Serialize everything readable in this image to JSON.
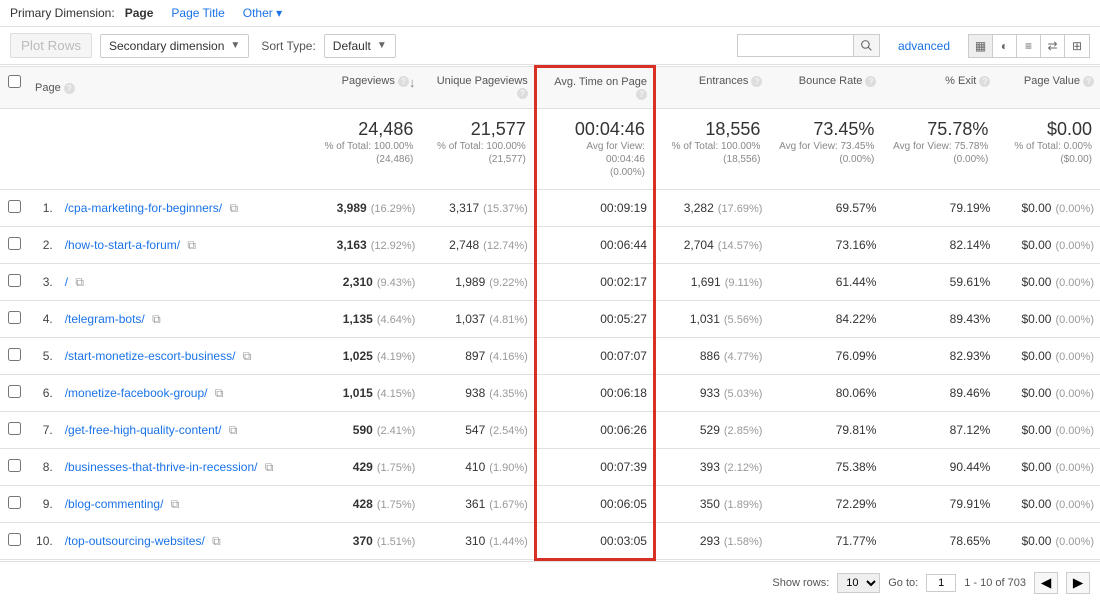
{
  "primaryDimension": {
    "label": "Primary Dimension:",
    "tabs": [
      "Page",
      "Page Title",
      "Other ▾"
    ]
  },
  "controls": {
    "plotRows": "Plot Rows",
    "secondaryDimension": "Secondary dimension",
    "sortTypeLabel": "Sort Type:",
    "sortTypeValue": "Default",
    "advanced": "advanced"
  },
  "columns": {
    "page": "Page",
    "pageviews": "Pageviews",
    "uniquePageviews": "Unique Pageviews",
    "avgTime": "Avg. Time on Page",
    "entrances": "Entrances",
    "bounceRate": "Bounce Rate",
    "pctExit": "% Exit",
    "pageValue": "Page Value"
  },
  "summary": {
    "pageviews": {
      "big": "24,486",
      "sub1": "% of Total: 100.00%",
      "sub2": "(24,486)"
    },
    "unique": {
      "big": "21,577",
      "sub1": "% of Total: 100.00%",
      "sub2": "(21,577)"
    },
    "avg": {
      "big": "00:04:46",
      "sub1": "Avg for View: 00:04:46",
      "sub2": "(0.00%)"
    },
    "entrances": {
      "big": "18,556",
      "sub1": "% of Total: 100.00%",
      "sub2": "(18,556)"
    },
    "bounce": {
      "big": "73.45%",
      "sub1": "Avg for View: 73.45%",
      "sub2": "(0.00%)"
    },
    "exit": {
      "big": "75.78%",
      "sub1": "Avg for View: 75.78%",
      "sub2": "(0.00%)"
    },
    "value": {
      "big": "$0.00",
      "sub1": "% of Total: 0.00%",
      "sub2": "($0.00)"
    }
  },
  "rows": [
    {
      "i": "1.",
      "page": "/cpa-marketing-for-beginners/",
      "pv": "3,989",
      "pvp": "(16.29%)",
      "upv": "3,317",
      "upvp": "(15.37%)",
      "avg": "00:09:19",
      "ent": "3,282",
      "entp": "(17.69%)",
      "bounce": "69.57%",
      "exit": "79.19%",
      "val": "$0.00",
      "valp": "(0.00%)"
    },
    {
      "i": "2.",
      "page": "/how-to-start-a-forum/",
      "pv": "3,163",
      "pvp": "(12.92%)",
      "upv": "2,748",
      "upvp": "(12.74%)",
      "avg": "00:06:44",
      "ent": "2,704",
      "entp": "(14.57%)",
      "bounce": "73.16%",
      "exit": "82.14%",
      "val": "$0.00",
      "valp": "(0.00%)"
    },
    {
      "i": "3.",
      "page": "/",
      "pv": "2,310",
      "pvp": "(9.43%)",
      "upv": "1,989",
      "upvp": "(9.22%)",
      "avg": "00:02:17",
      "ent": "1,691",
      "entp": "(9.11%)",
      "bounce": "61.44%",
      "exit": "59.61%",
      "val": "$0.00",
      "valp": "(0.00%)"
    },
    {
      "i": "4.",
      "page": "/telegram-bots/",
      "pv": "1,135",
      "pvp": "(4.64%)",
      "upv": "1,037",
      "upvp": "(4.81%)",
      "avg": "00:05:27",
      "ent": "1,031",
      "entp": "(5.56%)",
      "bounce": "84.22%",
      "exit": "89.43%",
      "val": "$0.00",
      "valp": "(0.00%)"
    },
    {
      "i": "5.",
      "page": "/start-monetize-escort-business/",
      "pv": "1,025",
      "pvp": "(4.19%)",
      "upv": "897",
      "upvp": "(4.16%)",
      "avg": "00:07:07",
      "ent": "886",
      "entp": "(4.77%)",
      "bounce": "76.09%",
      "exit": "82.93%",
      "val": "$0.00",
      "valp": "(0.00%)"
    },
    {
      "i": "6.",
      "page": "/monetize-facebook-group/",
      "pv": "1,015",
      "pvp": "(4.15%)",
      "upv": "938",
      "upvp": "(4.35%)",
      "avg": "00:06:18",
      "ent": "933",
      "entp": "(5.03%)",
      "bounce": "80.06%",
      "exit": "89.46%",
      "val": "$0.00",
      "valp": "(0.00%)"
    },
    {
      "i": "7.",
      "page": "/get-free-high-quality-content/",
      "pv": "590",
      "pvp": "(2.41%)",
      "upv": "547",
      "upvp": "(2.54%)",
      "avg": "00:06:26",
      "ent": "529",
      "entp": "(2.85%)",
      "bounce": "79.81%",
      "exit": "87.12%",
      "val": "$0.00",
      "valp": "(0.00%)"
    },
    {
      "i": "8.",
      "page": "/businesses-that-thrive-in-recession/",
      "pv": "429",
      "pvp": "(1.75%)",
      "upv": "410",
      "upvp": "(1.90%)",
      "avg": "00:07:39",
      "ent": "393",
      "entp": "(2.12%)",
      "bounce": "75.38%",
      "exit": "90.44%",
      "val": "$0.00",
      "valp": "(0.00%)"
    },
    {
      "i": "9.",
      "page": "/blog-commenting/",
      "pv": "428",
      "pvp": "(1.75%)",
      "upv": "361",
      "upvp": "(1.67%)",
      "avg": "00:06:05",
      "ent": "350",
      "entp": "(1.89%)",
      "bounce": "72.29%",
      "exit": "79.91%",
      "val": "$0.00",
      "valp": "(0.00%)"
    },
    {
      "i": "10.",
      "page": "/top-outsourcing-websites/",
      "pv": "370",
      "pvp": "(1.51%)",
      "upv": "310",
      "upvp": "(1.44%)",
      "avg": "00:03:05",
      "ent": "293",
      "entp": "(1.58%)",
      "bounce": "71.77%",
      "exit": "78.65%",
      "val": "$0.00",
      "valp": "(0.00%)"
    }
  ],
  "footer": {
    "showRows": "Show rows:",
    "rowsValue": "10",
    "goTo": "Go to:",
    "goValue": "1",
    "range": "1 - 10 of 703"
  }
}
